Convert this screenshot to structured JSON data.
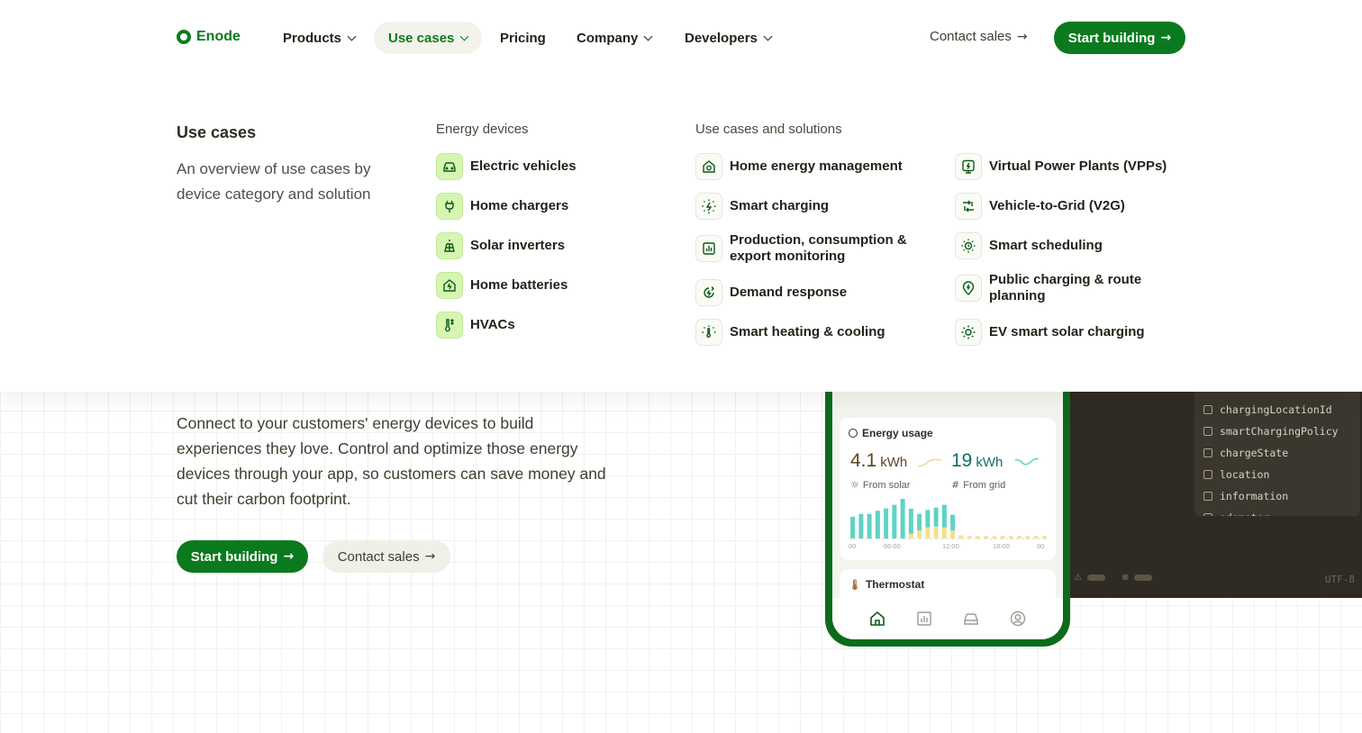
{
  "brand": {
    "name": "Enode",
    "color": "#0b7a1e"
  },
  "nav": {
    "items": [
      {
        "label": "Products",
        "has_dropdown": true,
        "active": false
      },
      {
        "label": "Use cases",
        "has_dropdown": true,
        "active": true
      },
      {
        "label": "Pricing",
        "has_dropdown": false,
        "active": false
      },
      {
        "label": "Company",
        "has_dropdown": true,
        "active": false
      },
      {
        "label": "Developers",
        "has_dropdown": true,
        "active": false
      }
    ],
    "contact_sales": "Contact sales",
    "start_building": "Start building"
  },
  "mega": {
    "title": "Use cases",
    "description": "An overview of use cases by device category and solution",
    "energy_devices": {
      "heading": "Energy devices",
      "items": [
        {
          "label": "Electric vehicles",
          "icon": "car-icon"
        },
        {
          "label": "Home chargers",
          "icon": "plug-icon"
        },
        {
          "label": "Solar inverters",
          "icon": "solar-panel-icon"
        },
        {
          "label": "Home batteries",
          "icon": "home-battery-icon"
        },
        {
          "label": "HVACs",
          "icon": "thermometer-icon"
        }
      ]
    },
    "solutions": {
      "heading": "Use cases and solutions",
      "col1": [
        {
          "label": "Home energy management",
          "icon": "home-energy-icon"
        },
        {
          "label": "Smart charging",
          "icon": "smart-charging-icon"
        },
        {
          "label": "Production, consumption & export monitoring",
          "icon": "monitoring-chart-icon"
        },
        {
          "label": "Demand response",
          "icon": "demand-response-icon"
        },
        {
          "label": "Smart heating & cooling",
          "icon": "heating-cooling-icon"
        }
      ],
      "col2": [
        {
          "label": "Virtual Power Plants (VPPs)",
          "icon": "vpp-icon"
        },
        {
          "label": "Vehicle-to-Grid (V2G)",
          "icon": "v2g-icon"
        },
        {
          "label": "Smart scheduling",
          "icon": "sun-schedule-icon"
        },
        {
          "label": "Public charging & route planning",
          "icon": "location-pin-icon"
        },
        {
          "label": "EV smart solar charging",
          "icon": "sun-icon"
        }
      ]
    }
  },
  "hero": {
    "description": "Connect to your customers' energy devices to build experiences they love. Control and optimize those energy devices through your app, so customers can save money and cut their carbon footprint.",
    "start_building": "Start building",
    "contact_sales": "Contact sales"
  },
  "code_panel": {
    "fields": [
      "chargingLocationId",
      "smartChargingPolicy",
      "chargeState",
      "location",
      "information",
      "odometer"
    ],
    "encoding": "UTF-8"
  },
  "phone": {
    "energy_card": {
      "title": "Energy usage",
      "solar_value": "4.1",
      "solar_unit": "kWh",
      "solar_label": "From solar",
      "grid_value": "19",
      "grid_unit": "kWh",
      "grid_label": "From grid",
      "axis_ticks": [
        "00",
        "06:00",
        "12:00",
        "18:00",
        "00"
      ]
    },
    "thermostat_card": {
      "title": "Thermostat"
    },
    "chart_data": {
      "type": "bar",
      "series": [
        {
          "values": [
            0.55,
            0.62,
            0.62,
            0.7,
            0.76,
            0.85,
            1.0,
            0.75,
            0.62,
            0.72,
            0.78,
            0.85,
            0.6,
            0,
            0,
            0,
            0,
            0,
            0,
            0,
            0,
            0,
            0,
            0
          ],
          "color": "#5fd3c5"
        },
        {
          "values": [
            0,
            0,
            0,
            0,
            0,
            0,
            0,
            0.12,
            0.2,
            0.28,
            0.3,
            0.28,
            0.2,
            0.08,
            0.06,
            0.06,
            0.06,
            0.06,
            0.06,
            0.06,
            0.06,
            0.06,
            0.06,
            0.06
          ],
          "color": "#f3e08e"
        }
      ]
    },
    "tabs": [
      "home-icon",
      "chart-icon",
      "car-icon",
      "profile-icon"
    ]
  }
}
